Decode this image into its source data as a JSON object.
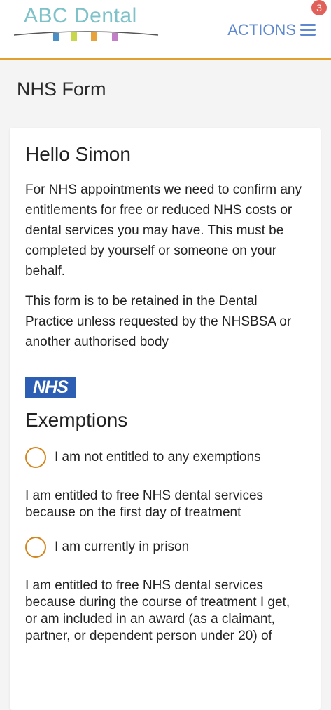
{
  "header": {
    "logo_text": "ABC Dental",
    "actions_label": "ACTIONS",
    "badge_count": "3",
    "colors": {
      "accent": "#e0a12e",
      "actions": "#5e88cf",
      "badge": "#e1605a",
      "logo": "#7dc2c8"
    }
  },
  "page": {
    "title": "NHS Form"
  },
  "card": {
    "greeting": "Hello Simon",
    "intro": "For NHS appointments we need to confirm any entitlements for free or reduced NHS costs or dental services you may have. This must be completed by yourself or someone on your behalf.",
    "retention": "This form is to be retained in the Dental Practice unless requested by the NHSBSA or another authorised body",
    "nhs_logo": "NHS",
    "exemptions_title": "Exemptions",
    "option_none": "I am not entitled to any exemptions",
    "statement_first_day": "I am entitled to free NHS dental services because on the first day of treatment",
    "option_prison": "I am currently in prison",
    "statement_award": "I am entitled to free NHS dental services because during the course of treatment I get, or am included in an award (as a claimant, partner, or dependent person under 20) of"
  }
}
